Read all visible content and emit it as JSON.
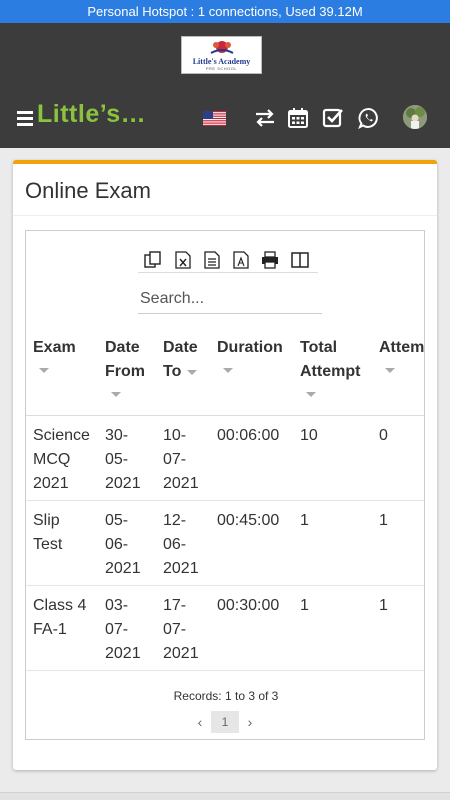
{
  "status_bar": {
    "text": "Personal Hotspot : 1 connections, Used 39.12M"
  },
  "header": {
    "logo_name": "Little's Academy",
    "logo_sub": "PRE SCHOOL",
    "app_title": "Little’s…",
    "icons": [
      "menu-icon",
      "us-flag-icon",
      "switch-icon",
      "calendar-icon",
      "checkbox-icon",
      "whatsapp-icon",
      "avatar"
    ]
  },
  "page": {
    "title": "Online Exam"
  },
  "toolbar": {
    "export_icons": [
      "copy-icon",
      "excel-icon",
      "csv-icon",
      "pdf-icon",
      "print-icon",
      "columns-icon"
    ],
    "search_placeholder": "Search..."
  },
  "table": {
    "columns": [
      {
        "line1": "Exam",
        "line2": ""
      },
      {
        "line1": "Date",
        "line2": "From"
      },
      {
        "line1": "Date",
        "line2": "To"
      },
      {
        "line1": "Duration",
        "line2": ""
      },
      {
        "line1": "Total",
        "line2": "Attempt"
      },
      {
        "line1": "Attem",
        "line2": ""
      }
    ],
    "rows": [
      {
        "exam": [
          "Science",
          "MCQ",
          "2021"
        ],
        "date_from": [
          "30-",
          "05-",
          "2021"
        ],
        "date_to": [
          "10-",
          "07-",
          "2021"
        ],
        "duration": "00:06:00",
        "total_attempt": "10",
        "attempted": "0"
      },
      {
        "exam": [
          "Slip",
          "Test",
          ""
        ],
        "date_from": [
          "05-",
          "06-",
          "2021"
        ],
        "date_to": [
          "12-",
          "06-",
          "2021"
        ],
        "duration": "00:45:00",
        "total_attempt": "1",
        "attempted": "1"
      },
      {
        "exam": [
          "Class 4",
          "FA-1",
          ""
        ],
        "date_from": [
          "03-",
          "07-",
          "2021"
        ],
        "date_to": [
          "17-",
          "07-",
          "2021"
        ],
        "duration": "00:30:00",
        "total_attempt": "1",
        "attempted": "1"
      }
    ]
  },
  "pagination": {
    "records_text": "Records: 1 to 3 of 3",
    "prev": "‹",
    "current": "1",
    "next": "›"
  },
  "colors": {
    "status_bar": "#2b7de1",
    "header_bg": "#3c3c3c",
    "title_green": "#8ac43f",
    "card_accent": "#f0a30a"
  }
}
